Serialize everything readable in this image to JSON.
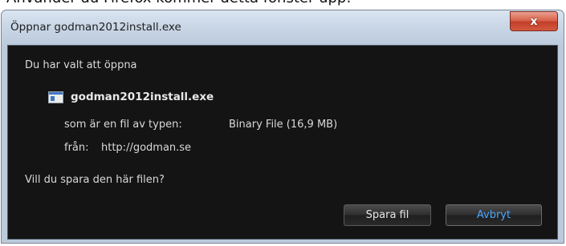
{
  "background_caption": "Använder du Firefox kommer detta fönster upp:",
  "dialog": {
    "title": "Öppnar godman2012install.exe",
    "close_glyph": "x",
    "intro": "Du har valt att öppna",
    "file_icon": "exe-file-icon",
    "filename": "godman2012install.exe",
    "type_label": "som är en fil av typen:",
    "type_value": "Binary File (16,9 MB)",
    "from_label": "från:",
    "from_value": "http://godman.se",
    "question": "Vill du spara den här filen?",
    "save_label": "Spara fil",
    "cancel_label": "Avbryt"
  },
  "colors": {
    "content_bg": "#141414",
    "cancel_text": "#4aa6ff",
    "close_button": "#c2402a"
  }
}
